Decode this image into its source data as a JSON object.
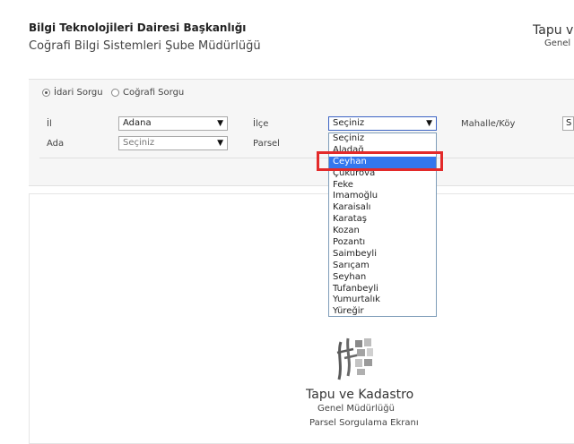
{
  "header": {
    "title": "Bilgi Teknolojileri Dairesi Başkanlığı",
    "subtitle": "Coğrafi Bilgi Sistemleri Şube Müdürlüğü",
    "right_title": "Tapu ve",
    "right_subtitle": "Genel"
  },
  "query_type": {
    "options": [
      "İdari Sorgu",
      "Coğrafi Sorgu"
    ],
    "selected": "İdari Sorgu"
  },
  "form": {
    "il_label": "İl",
    "il_value": "Adana",
    "ilce_label": "İlçe",
    "ilce_value": "Seçiniz",
    "mahalle_label": "Mahalle/Köy",
    "mahalle_value": "S",
    "ada_label": "Ada",
    "ada_value": "Seçiniz",
    "parsel_label": "Parsel"
  },
  "ilce_dropdown": {
    "options": [
      "Seçiniz",
      "Aladağ",
      "Ceyhan",
      "Çukurova",
      "Feke",
      "İmamoğlu",
      "Karaisalı",
      "Karataş",
      "Kozan",
      "Pozantı",
      "Saimbeyli",
      "Sarıçam",
      "Seyhan",
      "Tufanbeyli",
      "Yumurtalık",
      "Yüreğir"
    ],
    "highlighted": "Ceyhan"
  },
  "logo": {
    "line1": "Tapu ve Kadastro",
    "line2": "Genel Müdürlüğü",
    "line3": "Parsel Sorgulama Ekranı"
  },
  "colors": {
    "highlight": "#3377ee",
    "annotation_box": "#e32a2a",
    "panel_bg": "#f6f6f6"
  }
}
